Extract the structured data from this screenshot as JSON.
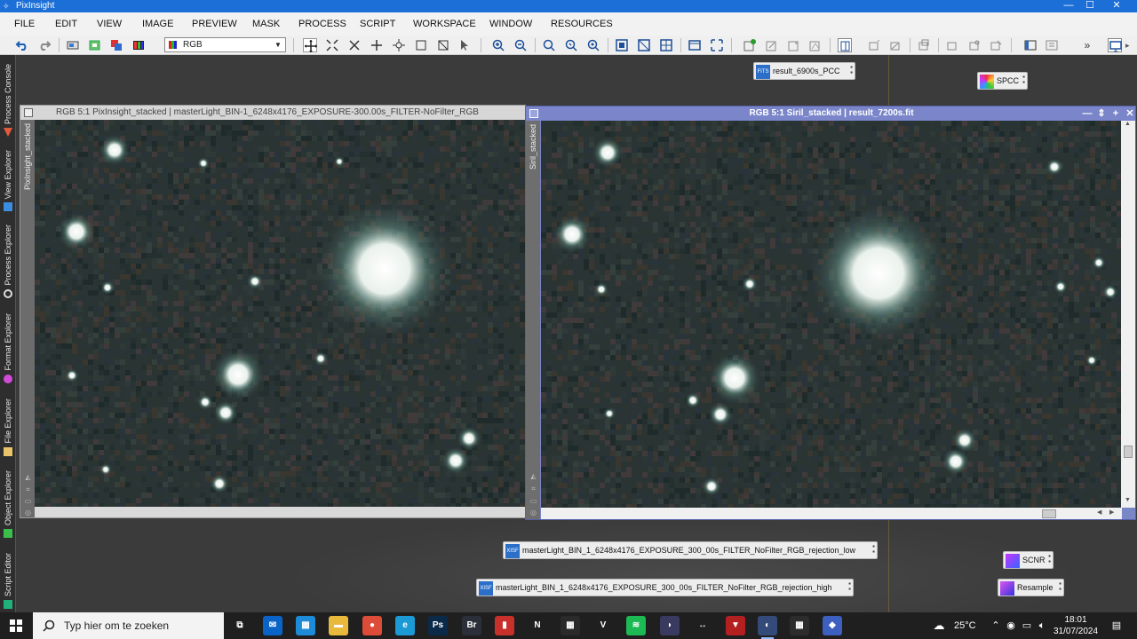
{
  "app": {
    "title": "PixInsight"
  },
  "window_controls": {
    "minimize": "—",
    "maximize": "☐",
    "close": "✕"
  },
  "menu": [
    "FILE",
    "EDIT",
    "VIEW",
    "IMAGE",
    "PREVIEW",
    "MASK",
    "PROCESS",
    "SCRIPT",
    "WORKSPACE",
    "WINDOW",
    "RESOURCES"
  ],
  "toolbar": {
    "channel_select": {
      "value": "RGB"
    },
    "overflow": "»"
  },
  "side_tabs": [
    "Process Console",
    "View Explorer",
    "Process Explorer",
    "Format Explorer",
    "File Explorer",
    "Object Explorer",
    "Script Editor"
  ],
  "workspace_icons": [
    {
      "label": "result_6900s_PCC",
      "badge": "FITS"
    },
    {
      "label": "SPCC",
      "badge": ""
    },
    {
      "label": "masterLight_BIN_1_6248x4176_EXPOSURE_300_00s_FILTER_NoFilter_RGB_rejection_low",
      "badge": "XISF"
    },
    {
      "label": "masterLight_BIN_1_6248x4176_EXPOSURE_300_00s_FILTER_NoFilter_RGB_rejection_high",
      "badge": "XISF"
    },
    {
      "label": "SCNR",
      "badge": ""
    },
    {
      "label": "Resample",
      "badge": ""
    }
  ],
  "image_windows": [
    {
      "title": "RGB 5:1 PixInsight_stacked | masterLight_BIN-1_6248x4176_EXPOSURE-300.00s_FILTER-NoFilter_RGB",
      "view_id": "PixInsight_stacked"
    },
    {
      "title": "RGB 5:1 Siril_stacked | result_7200s.fit",
      "view_id": "Siril_stacked",
      "controls": [
        "—",
        "⇕",
        "+",
        "✕"
      ]
    }
  ],
  "taskbar": {
    "search_placeholder": "Typ hier om te zoeken",
    "weather": "25°C",
    "time": "18:01",
    "date": "31/07/2024",
    "apps": [
      {
        "name": "task-view",
        "glyph": "⧉",
        "color": "#1f1f1f"
      },
      {
        "name": "mail",
        "glyph": "✉",
        "color": "#0a64c8"
      },
      {
        "name": "store",
        "glyph": "▦",
        "color": "#1d8bd8"
      },
      {
        "name": "file-explorer",
        "glyph": "▬",
        "color": "#e8b93a"
      },
      {
        "name": "chrome",
        "glyph": "●",
        "color": "#dd4b39"
      },
      {
        "name": "edge",
        "glyph": "e",
        "color": "#1c9ad6"
      },
      {
        "name": "photoshop",
        "glyph": "Ps",
        "color": "#0b2a4a"
      },
      {
        "name": "bridge",
        "glyph": "Br",
        "color": "#2b2f3a"
      },
      {
        "name": "chart-app",
        "glyph": "▮",
        "color": "#c8302b"
      },
      {
        "name": "netflix",
        "glyph": "N",
        "color": "#1f1f1f"
      },
      {
        "name": "calculator-app",
        "glyph": "▦",
        "color": "#2a2a2a"
      },
      {
        "name": "v-app",
        "glyph": "V",
        "color": "#1f1f1f"
      },
      {
        "name": "spotify",
        "glyph": "≋",
        "color": "#1db954"
      },
      {
        "name": "stellarium",
        "glyph": "◗",
        "color": "#3a3a60"
      },
      {
        "name": "teamviewer",
        "glyph": "↔",
        "color": "#1f1f1f"
      },
      {
        "name": "shield-app",
        "glyph": "▼",
        "color": "#b42020"
      },
      {
        "name": "pixinsight-taskbar",
        "glyph": "◐",
        "color": "#344b7a"
      },
      {
        "name": "calc",
        "glyph": "▦",
        "color": "#2c2c2c"
      },
      {
        "name": "diamond-app",
        "glyph": "◆",
        "color": "#3c5fc0"
      }
    ]
  }
}
